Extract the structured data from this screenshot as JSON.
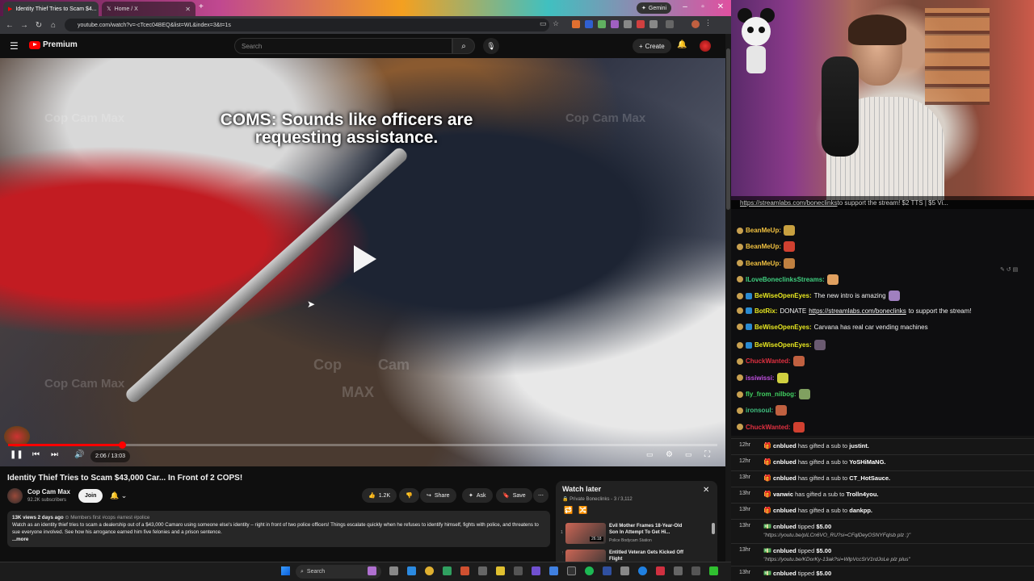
{
  "browser": {
    "tabs": [
      {
        "label": "Identity Thief Tries to Scam $4...",
        "active": true
      },
      {
        "label": "Home / X",
        "active": false
      }
    ],
    "gemini_label": "Gemini",
    "url": "youtube.com/watch?v=-cTcec04BEQ&list=WL&index=3&t=1s"
  },
  "youtube": {
    "brand": "Premium",
    "search_placeholder": "Search",
    "create_label": "Create",
    "video": {
      "caption_line1": "COMS:  Sounds like officers are",
      "caption_line2": "requesting assistance.",
      "watermarks": [
        "Cop Cam Max",
        "Cop Cam Max",
        "Cop Cam Max",
        "Cop",
        "Cam",
        "MAX"
      ],
      "time": "2:06 / 13:03",
      "progress": 0.161
    },
    "title": "Identity Thief Tries to Scam $43,000 Car... In Front of 2 COPS!",
    "channel": {
      "name": "Cop Cam Max",
      "subscribers": "92.2K subscribers",
      "join_label": "Join"
    },
    "actions": {
      "likes": "1.2K",
      "share": "Share",
      "ask": "Ask",
      "save": "Save"
    },
    "description": {
      "meta": "13K views  2 days ago",
      "tags": "Members first  #cops #arrest #police",
      "text": "Watch as an identity thief tries to scam a dealership out of a $43,000 Camaro using someone else's identity – right in front of two police officers! Things escalate quickly when he refuses to identify himself, fights with police, and threatens to sue everyone involved. See how his arrogance earned him five felonies and a prison sentence.",
      "more": "...more"
    },
    "watch_later": {
      "title": "Watch later",
      "subtitle": "Private Boneclinks - 3 / 3,112",
      "items": [
        {
          "index": "1",
          "title": "Evil Mother Frames 18-Year-Old Son In Attempt To Get Hi...",
          "channel": "Police Bodycam Station",
          "duration": "26:18"
        },
        {
          "index": "2",
          "title": "Entitled Veteran Gets Kicked Off Flight",
          "channel": "",
          "duration": ""
        }
      ]
    }
  },
  "taskbar": {
    "search_label": "Search"
  },
  "stream": {
    "banner_link": "https://streamlabs.com/boneclinks",
    "banner_text": " to support the stream! $2 TTS | $5 Vi...",
    "chat": [
      {
        "user": "BeanMeUp:",
        "color": "#f0c040",
        "text": "",
        "emote": "#c8a040"
      },
      {
        "user": "BeanMeUp:",
        "color": "#f0c040",
        "text": "",
        "emote": "#d04030"
      },
      {
        "user": "BeanMeUp:",
        "color": "#f0c040",
        "text": "",
        "emote": "#c08040"
      },
      {
        "user": "ILoveBoneclinksStreams:",
        "color": "#40d080",
        "text": "",
        "emote": "#e0a060"
      },
      {
        "user": "BeWiseOpenEyes:",
        "color": "#e8e820",
        "text": "The new intro is amazing",
        "emote": "#a080c0"
      },
      {
        "user": "BotRix:",
        "color": "#e8e820",
        "text": "DONATE ",
        "link": "https://streamlabs.com/boneclinks",
        "after": " to support the stream!",
        "emote": ""
      },
      {
        "user": "BeWiseOpenEyes:",
        "color": "#e8e820",
        "text": "Carvana has real car vending machines",
        "emote": ""
      },
      {
        "user": "BeWiseOpenEyes:",
        "color": "#e8e820",
        "text": "",
        "emote": "#6a5a70"
      },
      {
        "user": "ChuckWanted:",
        "color": "#e03040",
        "text": "",
        "emote": "#c06040"
      },
      {
        "user": "issiwissi:",
        "color": "#c050e0",
        "text": "",
        "emote": "#d0d040"
      },
      {
        "user": "fly_from_nilbog:",
        "color": "#40d060",
        "text": "",
        "emote": "#80a060"
      },
      {
        "user": "ironsoul:",
        "color": "#40c080",
        "text": "",
        "emote": "#c06040"
      },
      {
        "user": "ChuckWanted:",
        "color": "#e03040",
        "text": "",
        "emote": "#d04030"
      }
    ],
    "events": [
      {
        "time": "12hr",
        "user": "cnblued",
        "text": "has gifted a sub to ",
        "target": "justint.",
        "sub": ""
      },
      {
        "time": "12hr",
        "user": "cnblued",
        "text": "has gifted a sub to ",
        "target": "YoSHiMaNG.",
        "sub": ""
      },
      {
        "time": "13hr",
        "user": "cnblued",
        "text": "has gifted a sub to ",
        "target": "CT_HotSauce.",
        "sub": ""
      },
      {
        "time": "13hr",
        "user": "vanwic",
        "text": "has gifted a sub to ",
        "target": "Trolln4you.",
        "sub": ""
      },
      {
        "time": "13hr",
        "user": "cnblued",
        "text": "has gifted a sub to ",
        "target": "dankpp.",
        "sub": ""
      },
      {
        "time": "13hr",
        "user": "cnblued",
        "text": "tipped ",
        "target": "$5.00",
        "sub": "\"https://youtu.be/pILCn6VO_RU?si=CFqlDeyOSNYFqIsb plz :)\""
      },
      {
        "time": "13hr",
        "user": "cnblued",
        "text": "tipped ",
        "target": "$5.00",
        "sub": "\"https://youtu.be/KDorKy-13ak?si=WlpVccSrV1rdJoLe plz plus\""
      },
      {
        "time": "13hr",
        "user": "cnblued",
        "text": "tipped ",
        "target": "$5.00",
        "sub": ""
      }
    ]
  }
}
